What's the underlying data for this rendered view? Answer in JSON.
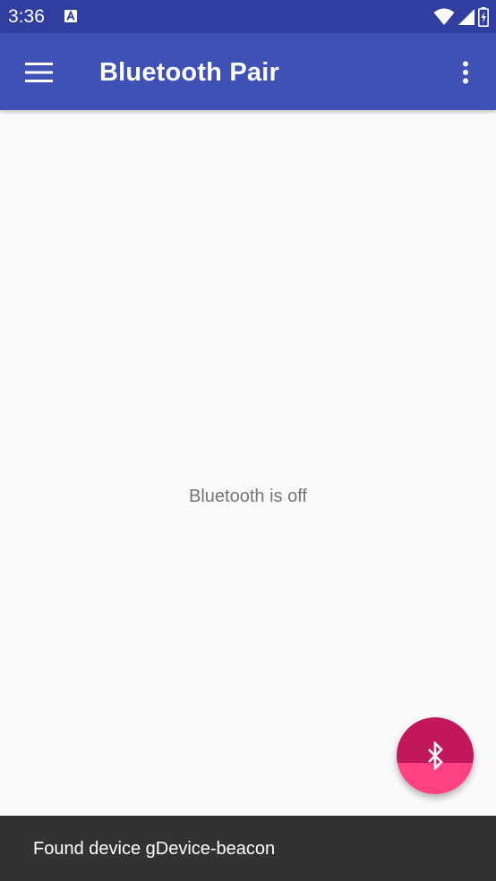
{
  "status_bar": {
    "time": "3:36",
    "icons": [
      "notification-a-icon",
      "wifi-icon",
      "signal-icon",
      "battery-charging-icon"
    ]
  },
  "app_bar": {
    "title": "Bluetooth Pair",
    "menu_icon": "hamburger-menu-icon",
    "overflow_icon": "more-vert-icon"
  },
  "content": {
    "message": "Bluetooth is off"
  },
  "fab": {
    "icon": "bluetooth-icon"
  },
  "snackbar": {
    "text": "Found device gDevice-beacon"
  },
  "colors": {
    "status_bar": "#303f9f",
    "app_bar": "#3f51b5",
    "background": "#fafafa",
    "fab_top": "#c2185b",
    "fab_bottom": "#ff4081",
    "snackbar": "#323232",
    "message_text": "#757575"
  }
}
